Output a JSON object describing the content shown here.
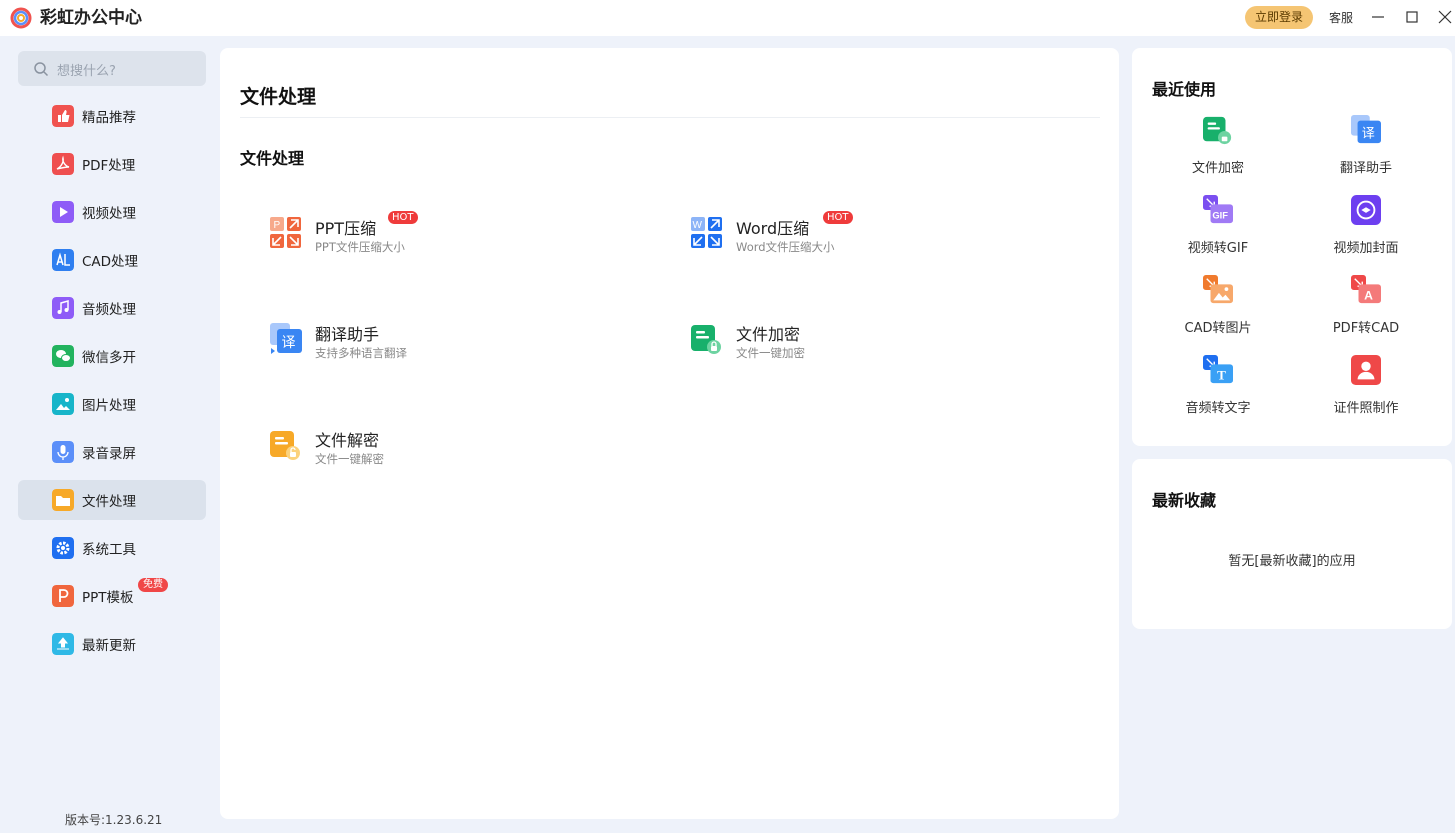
{
  "app": {
    "title": "彩虹办公中心"
  },
  "header": {
    "login_label": "立即登录",
    "service_label": "客服"
  },
  "search": {
    "placeholder": "想搜什么?"
  },
  "sidebar": {
    "items": [
      {
        "label": "精品推荐",
        "icon": "thumbs-up-icon",
        "color": "#f0534f"
      },
      {
        "label": "PDF处理",
        "icon": "pdf-icon",
        "color": "#ef4f4f"
      },
      {
        "label": "视频处理",
        "icon": "play-icon",
        "color": "#8e5cf7"
      },
      {
        "label": "CAD处理",
        "icon": "cad-icon",
        "color": "#2f7ff0"
      },
      {
        "label": "音频处理",
        "icon": "music-icon",
        "color": "#8e5cf7"
      },
      {
        "label": "微信多开",
        "icon": "wechat-icon",
        "color": "#22b35e"
      },
      {
        "label": "图片处理",
        "icon": "image-icon",
        "color": "#17b5c9"
      },
      {
        "label": "录音录屏",
        "icon": "microphone-icon",
        "color": "#5b8ff9"
      },
      {
        "label": "文件处理",
        "icon": "folder-icon",
        "color": "#f7a928"
      },
      {
        "label": "系统工具",
        "icon": "gear-icon",
        "color": "#1f6ff0"
      },
      {
        "label": "PPT模板",
        "icon": "ppt-icon",
        "color": "#f0663d",
        "badge": "免费"
      },
      {
        "label": "最新更新",
        "icon": "upload-icon",
        "color": "#2fb9e6"
      }
    ],
    "active": "文件处理"
  },
  "version": "版本号:1.23.6.21",
  "main": {
    "title": "文件处理",
    "section_title": "文件处理",
    "tools": [
      {
        "name": "PPT压缩",
        "desc": "PPT文件压缩大小",
        "badge": "HOT",
        "icon": "ppt-compress-icon"
      },
      {
        "name": "Word压缩",
        "desc": "Word文件压缩大小",
        "badge": "HOT",
        "icon": "word-compress-icon"
      },
      {
        "name": "翻译助手",
        "desc": "支持多种语言翻译",
        "icon": "translate-icon"
      },
      {
        "name": "文件加密",
        "desc": "文件一键加密",
        "icon": "file-encrypt-icon"
      },
      {
        "name": "文件解密",
        "desc": "文件一键解密",
        "icon": "file-decrypt-icon"
      }
    ]
  },
  "recent": {
    "title": "最近使用",
    "items": [
      {
        "label": "文件加密",
        "icon": "file-encrypt-icon"
      },
      {
        "label": "翻译助手",
        "icon": "translate-icon"
      },
      {
        "label": "视频转GIF",
        "icon": "video-to-gif-icon"
      },
      {
        "label": "视频加封面",
        "icon": "video-cover-icon"
      },
      {
        "label": "CAD转图片",
        "icon": "cad-to-image-icon"
      },
      {
        "label": "PDF转CAD",
        "icon": "pdf-to-cad-icon"
      },
      {
        "label": "音频转文字",
        "icon": "audio-to-text-icon"
      },
      {
        "label": "证件照制作",
        "icon": "id-photo-icon"
      }
    ]
  },
  "favorites": {
    "title": "最新收藏",
    "empty_text": "暂无[最新收藏]的应用"
  }
}
